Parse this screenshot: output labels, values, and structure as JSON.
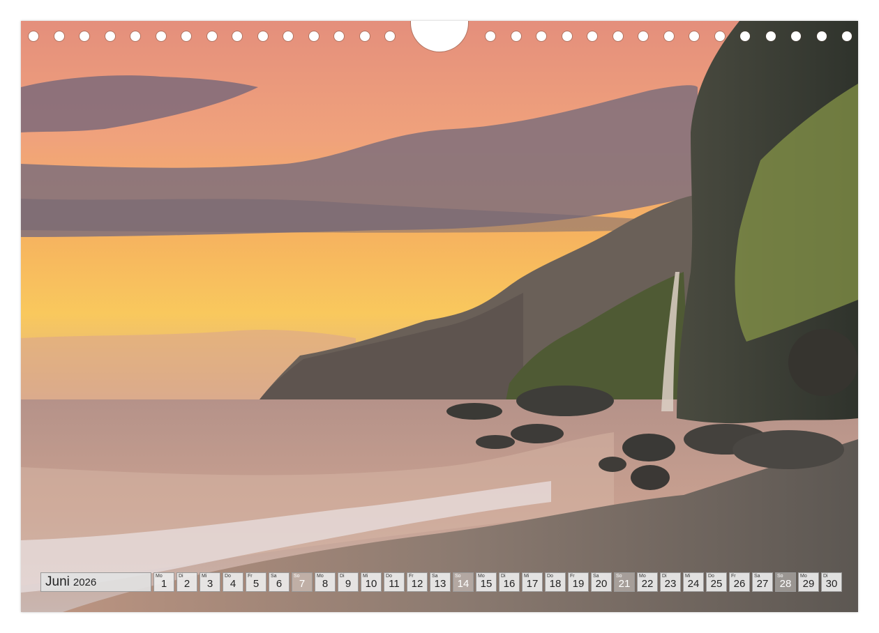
{
  "calendar": {
    "month": "Juni",
    "year": "2026",
    "days": [
      {
        "wd": "Mo",
        "d": "1"
      },
      {
        "wd": "Di",
        "d": "2"
      },
      {
        "wd": "Mi",
        "d": "3"
      },
      {
        "wd": "Do",
        "d": "4"
      },
      {
        "wd": "Fr",
        "d": "5"
      },
      {
        "wd": "Sa",
        "d": "6"
      },
      {
        "wd": "So",
        "d": "7"
      },
      {
        "wd": "Mo",
        "d": "8"
      },
      {
        "wd": "Di",
        "d": "9"
      },
      {
        "wd": "Mi",
        "d": "10"
      },
      {
        "wd": "Do",
        "d": "11"
      },
      {
        "wd": "Fr",
        "d": "12"
      },
      {
        "wd": "Sa",
        "d": "13"
      },
      {
        "wd": "So",
        "d": "14"
      },
      {
        "wd": "Mo",
        "d": "15"
      },
      {
        "wd": "Di",
        "d": "16"
      },
      {
        "wd": "Mi",
        "d": "17"
      },
      {
        "wd": "Do",
        "d": "18"
      },
      {
        "wd": "Fr",
        "d": "19"
      },
      {
        "wd": "Sa",
        "d": "20"
      },
      {
        "wd": "So",
        "d": "21"
      },
      {
        "wd": "Mo",
        "d": "22"
      },
      {
        "wd": "Di",
        "d": "23"
      },
      {
        "wd": "Mi",
        "d": "24"
      },
      {
        "wd": "Do",
        "d": "25"
      },
      {
        "wd": "Fr",
        "d": "26"
      },
      {
        "wd": "Sa",
        "d": "27"
      },
      {
        "wd": "So",
        "d": "28"
      },
      {
        "wd": "Mo",
        "d": "29"
      },
      {
        "wd": "Di",
        "d": "30"
      }
    ],
    "sunday_color": "#ffffff"
  },
  "colors": {
    "sky_top": "#e9987f",
    "sky_glow": "#f7c75e",
    "cloud": "#8a7784",
    "sea": "#c39a8e",
    "cliff": "#3f4038",
    "grass": "#8a9a48",
    "beach": "#6e6660"
  }
}
